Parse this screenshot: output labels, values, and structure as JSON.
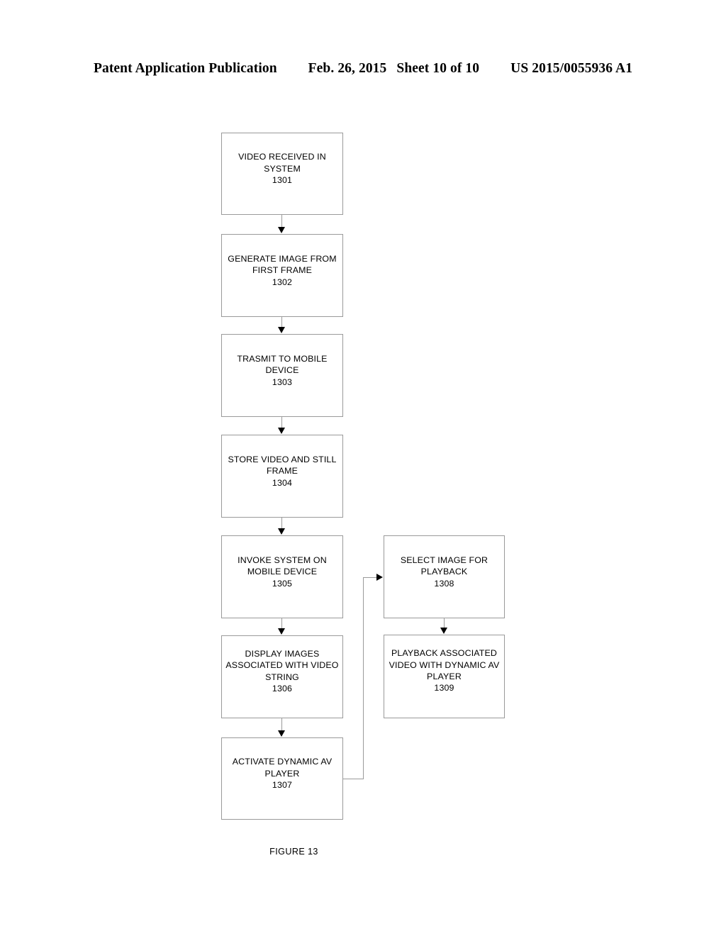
{
  "header": {
    "publication": "Patent Application Publication",
    "date": "Feb. 26, 2015",
    "sheet": "Sheet 10 of 10",
    "patent_number": "US 2015/0055936 A1"
  },
  "figure": {
    "caption": "FIGURE 13",
    "border_color": "#9a9a9a",
    "arrow_color": "#000000",
    "background_color": "#ffffff",
    "boxes": [
      {
        "id": "1301",
        "label": "VIDEO RECEIVED IN\nSYSTEM\n1301",
        "column": "left"
      },
      {
        "id": "1302",
        "label": "GENERATE IMAGE FROM\nFIRST FRAME\n1302",
        "column": "left"
      },
      {
        "id": "1303",
        "label": "TRASMIT TO MOBILE\nDEVICE\n1303",
        "column": "left"
      },
      {
        "id": "1304",
        "label": "STORE VIDEO AND STILL\nFRAME\n1304",
        "column": "left"
      },
      {
        "id": "1305",
        "label": "INVOKE SYSTEM ON\nMOBILE DEVICE\n1305",
        "column": "left"
      },
      {
        "id": "1306",
        "label": "DISPLAY IMAGES\nASSOCIATED WITH VIDEO\nSTRING\n1306",
        "column": "left"
      },
      {
        "id": "1307",
        "label": "ACTIVATE DYNAMIC AV\nPLAYER\n1307",
        "column": "left"
      },
      {
        "id": "1308",
        "label": "SELECT IMAGE FOR\nPLAYBACK\n1308",
        "column": "right"
      },
      {
        "id": "1309",
        "label": "PLAYBACK ASSOCIATED\nVIDEO WITH DYNAMIC AV\nPLAYER\n1309",
        "column": "right"
      }
    ],
    "connections": [
      {
        "from": "1301",
        "to": "1302",
        "kind": "straight-down"
      },
      {
        "from": "1302",
        "to": "1303",
        "kind": "straight-down"
      },
      {
        "from": "1303",
        "to": "1304",
        "kind": "straight-down"
      },
      {
        "from": "1304",
        "to": "1305",
        "kind": "straight-down"
      },
      {
        "from": "1305",
        "to": "1306",
        "kind": "straight-down"
      },
      {
        "from": "1306",
        "to": "1307",
        "kind": "straight-down"
      },
      {
        "from": "1307",
        "to": "1308",
        "kind": "elbow-right-up-right"
      },
      {
        "from": "1308",
        "to": "1309",
        "kind": "straight-down"
      }
    ]
  }
}
